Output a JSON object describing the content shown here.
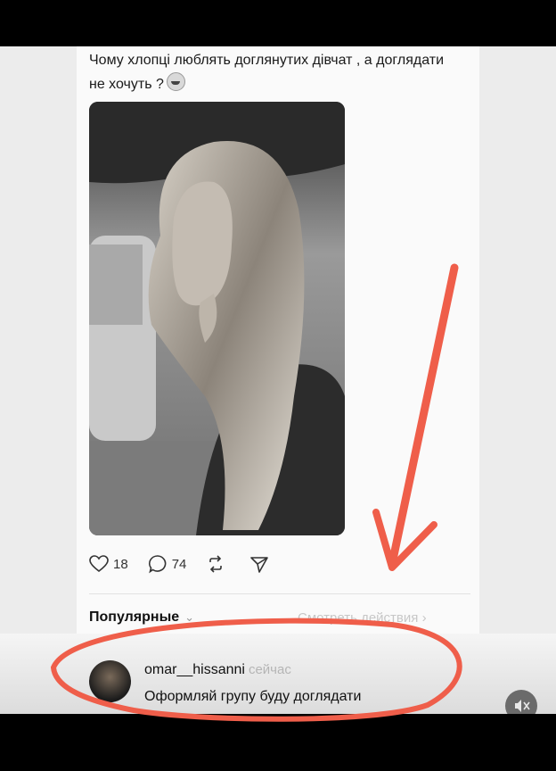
{
  "post": {
    "text": "Чому хлопці люблять доглянутих дівчат , а доглядати не хочуть ?",
    "emoji_icon": "grinning-sweat-emoji"
  },
  "actions": {
    "likes": "18",
    "comments": "74"
  },
  "section": {
    "popular_label": "Популярные",
    "view_actions": "Смотреть действия"
  },
  "comment": {
    "username": "omar__hissanni",
    "time": "сейчас",
    "text": "Оформляй групу буду доглядати"
  },
  "colors": {
    "annotation": "#ef5e4a"
  }
}
